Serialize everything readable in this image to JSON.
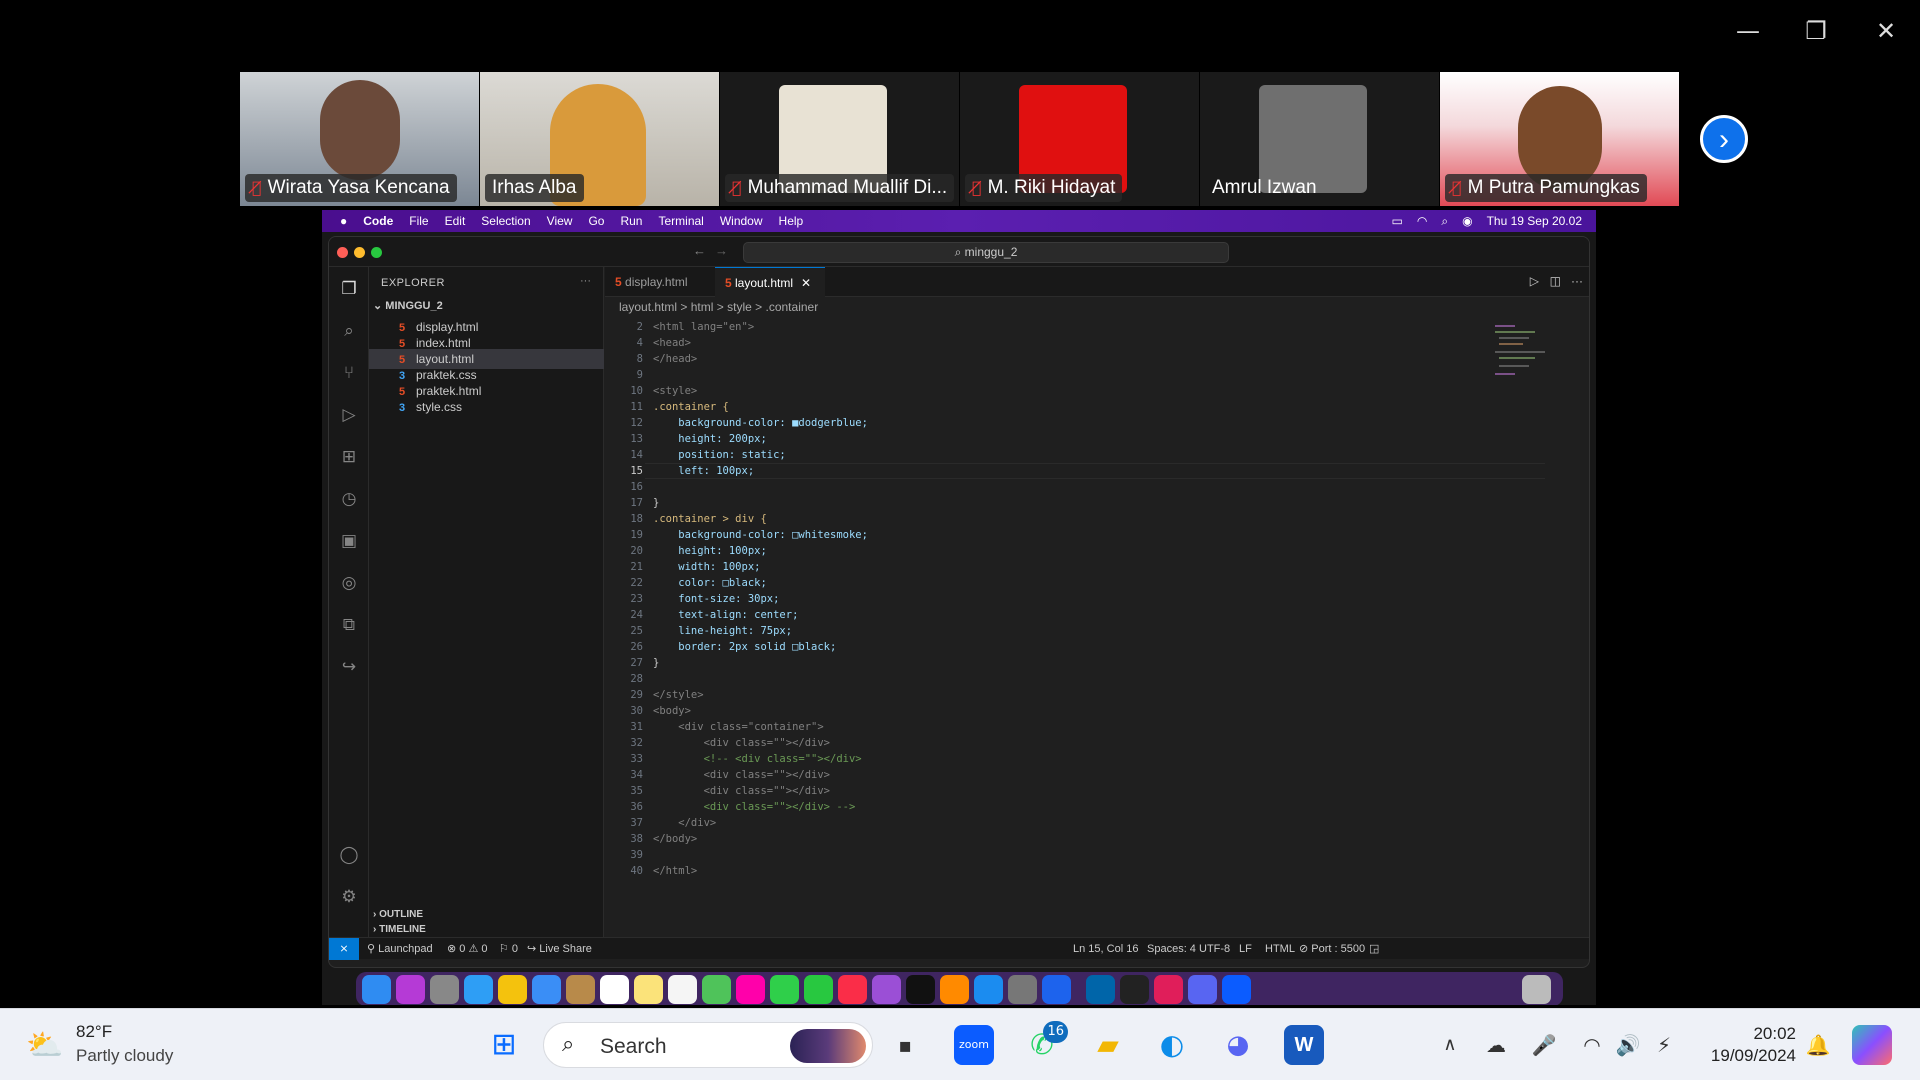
{
  "participants": [
    {
      "name": "Wirata Yasa Kencana",
      "muted": true
    },
    {
      "name": "Irhas Alba",
      "muted": false,
      "speaking": true
    },
    {
      "name": "Muhammad Muallif Di...",
      "muted": true
    },
    {
      "name": "M. Riki Hidayat",
      "muted": true
    },
    {
      "name": "Amrul Izwan",
      "muted": false
    },
    {
      "name": "M Putra Pamungkas",
      "muted": true
    }
  ],
  "mac_menu": {
    "app": "Code",
    "items": [
      "File",
      "Edit",
      "Selection",
      "View",
      "Go",
      "Run",
      "Terminal",
      "Window",
      "Help"
    ],
    "clock": "Thu 19 Sep  20.02"
  },
  "vscode": {
    "command_center": "minggu_2",
    "explorer_title": "EXPLORER",
    "folder": "MINGGU_2",
    "files": [
      {
        "name": "display.html",
        "type": "html"
      },
      {
        "name": "index.html",
        "type": "html"
      },
      {
        "name": "layout.html",
        "type": "html",
        "selected": true
      },
      {
        "name": "praktek.css",
        "type": "css"
      },
      {
        "name": "praktek.html",
        "type": "html"
      },
      {
        "name": "style.css",
        "type": "css"
      }
    ],
    "outline": "OUTLINE",
    "timeline": "TIMELINE",
    "tabs": [
      {
        "label": "display.html",
        "active": false
      },
      {
        "label": "layout.html",
        "active": true
      }
    ],
    "breadcrumb": {
      "file": "layout.html",
      "sep1": ">",
      "html": "html",
      "sep2": ">",
      "style": "style",
      "sep3": ">",
      "container": ".container"
    },
    "code_lines": [
      {
        "n": "2",
        "t": "<html lang=\"en\">"
      },
      {
        "n": "4",
        "t": "<head>"
      },
      {
        "n": "8",
        "t": "</head>"
      },
      {
        "n": "9",
        "t": ""
      },
      {
        "n": "10",
        "t": "<style>"
      },
      {
        "n": "11",
        "t": ".container {"
      },
      {
        "n": "12",
        "t": "    background-color: ■dodgerblue;"
      },
      {
        "n": "13",
        "t": "    height: 200px;"
      },
      {
        "n": "14",
        "t": "    position: static;"
      },
      {
        "n": "15",
        "t": "    left: 100px;"
      },
      {
        "n": "16",
        "t": ""
      },
      {
        "n": "17",
        "t": "}"
      },
      {
        "n": "18",
        "t": ".container > div {"
      },
      {
        "n": "19",
        "t": "    background-color: □whitesmoke;"
      },
      {
        "n": "20",
        "t": "    height: 100px;"
      },
      {
        "n": "21",
        "t": "    width: 100px;"
      },
      {
        "n": "22",
        "t": "    color: □black;"
      },
      {
        "n": "23",
        "t": "    font-size: 30px;"
      },
      {
        "n": "24",
        "t": "    text-align: center;"
      },
      {
        "n": "25",
        "t": "    line-height: 75px;"
      },
      {
        "n": "26",
        "t": "    border: 2px solid □black;"
      },
      {
        "n": "27",
        "t": "}"
      },
      {
        "n": "28",
        "t": ""
      },
      {
        "n": "29",
        "t": "</style>"
      },
      {
        "n": "30",
        "t": "<body>"
      },
      {
        "n": "31",
        "t": "    <div class=\"container\">"
      },
      {
        "n": "32",
        "t": "        <div class=\"\"></div>"
      },
      {
        "n": "33",
        "t": "        <!-- <div class=\"\"></div>"
      },
      {
        "n": "34",
        "t": "        <div class=\"\"></div>"
      },
      {
        "n": "35",
        "t": "        <div class=\"\"></div>"
      },
      {
        "n": "36",
        "t": "        <div class=\"\"></div> -->"
      },
      {
        "n": "37",
        "t": "    </div>"
      },
      {
        "n": "38",
        "t": "</body>"
      },
      {
        "n": "39",
        "t": ""
      },
      {
        "n": "40",
        "t": "</html>"
      }
    ],
    "status": {
      "launchpad": "Launchpad",
      "problems": "⊗ 0 ⚠ 0",
      "ports": "⚐ 0",
      "live_share": "Live Share",
      "cursor": "Ln 15, Col 16",
      "spaces": "Spaces: 4",
      "encoding": "UTF-8",
      "eol": "LF",
      "language": "HTML",
      "port": "Port : 5500"
    }
  },
  "taskbar": {
    "temperature": "82°F",
    "weather": "Partly cloudy",
    "search_placeholder": "Search",
    "whatsapp_badge": "16",
    "time": "20:02",
    "date": "19/09/2024"
  },
  "colors": {
    "accent": "#0078d4",
    "mac_bar": "#5b1fb0",
    "zoom_blue": "#0e71eb",
    "speaking": "#36d17a"
  }
}
